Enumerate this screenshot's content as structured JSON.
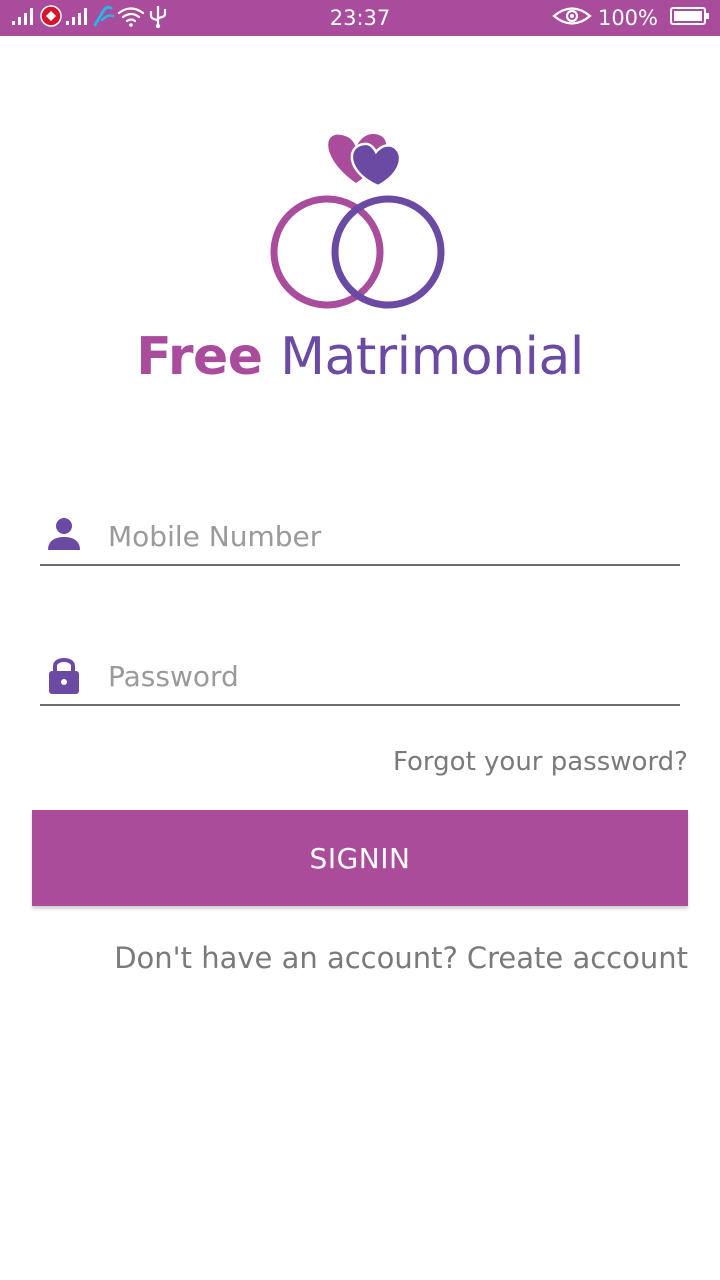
{
  "status_bar": {
    "time": "23:37",
    "battery_percent": "100%",
    "icons": [
      "signal-icon",
      "notification-icon",
      "signal-icon",
      "carrier-icon",
      "wifi-icon",
      "usb-icon",
      "eye-icon",
      "battery-icon"
    ],
    "color": "#a94c9c"
  },
  "logo": {
    "title_part1": "Free",
    "title_part2": "Matrimonial",
    "colors": {
      "pink": "#a94c9c",
      "purple": "#6a4aa3"
    }
  },
  "form": {
    "mobile": {
      "placeholder": "Mobile Number",
      "value": "",
      "icon": "person-icon"
    },
    "password": {
      "placeholder": "Password",
      "value": "",
      "icon": "lock-icon"
    },
    "forgot_label": "Forgot your password?",
    "signin_label": "SIGNIN",
    "signup_prompt": "Don't have an account?",
    "signup_link": "Create account"
  },
  "colors": {
    "accent": "#ab4c9b",
    "icon": "#6a4aa3",
    "text_muted": "#7a7a7a"
  }
}
